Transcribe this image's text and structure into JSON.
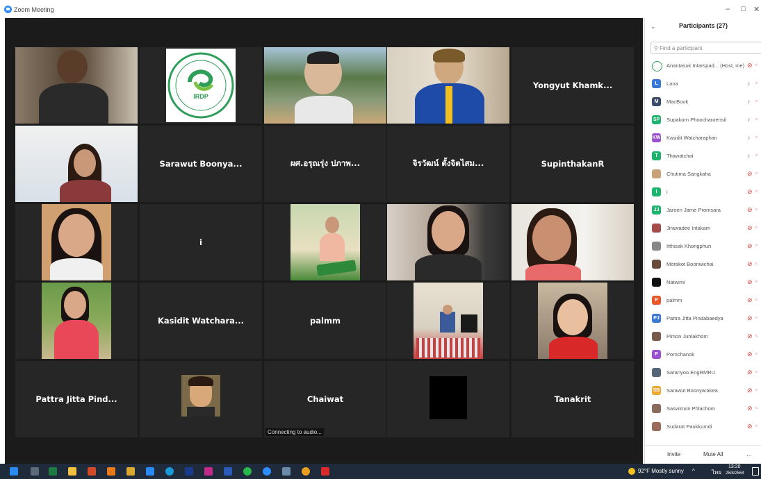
{
  "window": {
    "title": "Zoom Meeting",
    "controls": [
      "–",
      "□",
      "✕"
    ]
  },
  "colors": {
    "meeting_bg": "#1b1b1b",
    "tile_bg": "#262626",
    "active_speaker": "#e8e36a",
    "muted": "#e03a3a",
    "taskbar": "#1f2a3a"
  },
  "tiles": [
    {
      "name": "",
      "video": "person"
    },
    {
      "name": "",
      "video": "logo",
      "logo_text": "IRDP"
    },
    {
      "name": "",
      "video": "person"
    },
    {
      "name": "",
      "video": "person"
    },
    {
      "name": "Yongyut Khamk...",
      "video": "none"
    },
    {
      "name": "",
      "video": "person"
    },
    {
      "name": "Sarawut Boonya...",
      "video": "none"
    },
    {
      "name": "ผศ.อรุณรุ่ง ปภาพ...",
      "video": "none"
    },
    {
      "name": "จิรวัฒน์ ตั้งจิตไสม...",
      "video": "none"
    },
    {
      "name": "SupinthakanR",
      "video": "none"
    },
    {
      "name": "",
      "video": "person"
    },
    {
      "name": "i",
      "video": "none"
    },
    {
      "name": "",
      "video": "person"
    },
    {
      "name": "",
      "video": "person"
    },
    {
      "name": "",
      "video": "person"
    },
    {
      "name": "",
      "video": "person"
    },
    {
      "name": "Kasidit Watchara...",
      "video": "none"
    },
    {
      "name": "palmm",
      "video": "none"
    },
    {
      "name": "",
      "video": "person"
    },
    {
      "name": "",
      "video": "person"
    },
    {
      "name": "Pattra Jitta Pind...",
      "video": "none"
    },
    {
      "name": "",
      "video": "avatar"
    },
    {
      "name": "Chaiwat",
      "video": "none",
      "status": "Connecting to audio..."
    },
    {
      "name": "",
      "video": "black"
    },
    {
      "name": "Tanakrit",
      "video": "none"
    }
  ],
  "participants": {
    "header": "Participants (27)",
    "search_placeholder": "Find a participant",
    "list": [
      {
        "initials": "",
        "color": "#ffffff",
        "name": "Anantasuk Intarspad... (Host, me)",
        "muted": true
      },
      {
        "initials": "L",
        "color": "#3a78d8",
        "name": "Lana",
        "muted": false
      },
      {
        "initials": "M",
        "color": "#3a4a6a",
        "name": "MacBook",
        "muted": false
      },
      {
        "initials": "SP",
        "color": "#1fb46e",
        "name": "Supakorn Phoocharoensil",
        "muted": false
      },
      {
        "initials": "KW",
        "color": "#9b4fd1",
        "name": "Kasidit Watcharaphan",
        "muted": false
      },
      {
        "initials": "T",
        "color": "#1fb46e",
        "name": "Thawatchai",
        "muted": false
      },
      {
        "initials": "",
        "color": "#c9a27a",
        "name": "Chutima Sangkaha",
        "muted": true
      },
      {
        "initials": "I",
        "color": "#1fb46e",
        "name": "i",
        "muted": true
      },
      {
        "initials": "JJ",
        "color": "#1fb46e",
        "name": "Jaroen Jame Promsara",
        "muted": true
      },
      {
        "initials": "",
        "color": "#a54b4b",
        "name": "Jirawadee Intakam",
        "muted": true
      },
      {
        "initials": "",
        "color": "#888888",
        "name": "Itthisak Khongphun",
        "muted": true
      },
      {
        "initials": "",
        "color": "#6a4a3a",
        "name": "Morakot Boonwichai",
        "muted": true
      },
      {
        "initials": "",
        "color": "#111111",
        "name": "Natwimi",
        "muted": true
      },
      {
        "initials": "P",
        "color": "#e8572a",
        "name": "palmm",
        "muted": true
      },
      {
        "initials": "PJ",
        "color": "#3a78d8",
        "name": "Pattra Jitta Pindabaedya",
        "muted": true
      },
      {
        "initials": "",
        "color": "#7a5a4a",
        "name": "Pimon Junlakhom",
        "muted": true
      },
      {
        "initials": "P",
        "color": "#9b4fd1",
        "name": "Pornchanok",
        "muted": true
      },
      {
        "initials": "",
        "color": "#556677",
        "name": "Saranyoo.EngRMRU",
        "muted": true
      },
      {
        "initials": "SB",
        "color": "#f0a830",
        "name": "Sarawut Boonyarakea",
        "muted": true
      },
      {
        "initials": "",
        "color": "#8a6a5a",
        "name": "Saswimon Phlachom",
        "muted": true
      },
      {
        "initials": "",
        "color": "#9a6a5a",
        "name": "Sudarat Paukkumdi",
        "muted": true
      }
    ],
    "invite_label": "Invite",
    "mute_all_label": "Mute All"
  },
  "taskbar": {
    "weather": "92°F  Mostly sunny",
    "lang": "ไทย",
    "time": "13:20",
    "date": "25/8/2564"
  }
}
